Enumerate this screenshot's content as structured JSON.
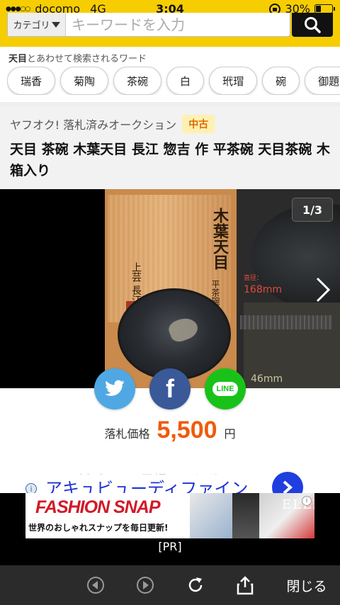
{
  "status_bar": {
    "signal": "●●●○○",
    "carrier": "docomo",
    "network": "4G",
    "time": "3:04",
    "battery_percent": "30%",
    "battery_level": 0.3
  },
  "search": {
    "category_label": "カテゴリ",
    "placeholder": "キーワードを入力"
  },
  "related": {
    "label_bold": "天目",
    "label_rest": "とあわせて検索されるワード",
    "chips": [
      "瑞香",
      "菊陶",
      "茶碗",
      "白",
      "玳瑁",
      "碗",
      "御題茶"
    ]
  },
  "item": {
    "source": "ヤフオク! 落札済みオークション",
    "condition": "中古",
    "title": "天目 茶碗 木葉天目 長江 惣吉 作 平茶碗 天目茶碗 木箱入り"
  },
  "gallery": {
    "counter": "1/3",
    "photo_text": {
      "box_title": "木葉天目",
      "box_author": "上芸 長江作",
      "box_type": "平茶碗",
      "measure_label": "直径：",
      "measure_diameter": "168mm",
      "measure_height": "46mm"
    }
  },
  "price": {
    "label": "落札価格",
    "value": "5,500",
    "unit": "円"
  },
  "faded_text": "2つの新デザイン登場！スケボメ",
  "ad": {
    "headline": "アキュビューディファイン",
    "banner_logo": "FASHION SNAP",
    "banner_sub": "世界のおしゃれスナップを毎日更新!",
    "banner_brand": "ELLE",
    "pr_label": "[PR]"
  },
  "toolbar": {
    "close_label": "閉じる"
  },
  "colors": {
    "header_yellow": "#f6cd00",
    "price_orange": "#f05a0a",
    "twitter_blue": "#4fa8e3",
    "facebook_blue": "#3a5998",
    "line_green": "#19c219",
    "ad_link_blue": "#1e33d6"
  }
}
